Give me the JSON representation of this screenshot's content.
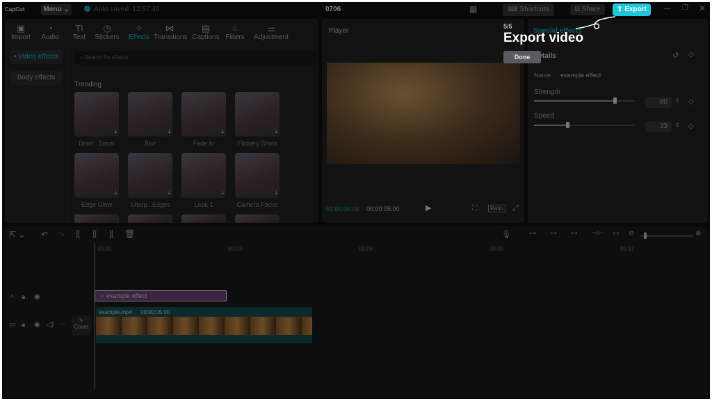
{
  "titlebar": {
    "logo": "CapCut",
    "menu": "Menu",
    "autosave": "Auto saved: 12:57:46",
    "project": "0706",
    "shortcuts": "Shortcuts",
    "share": "Share",
    "export": "Export"
  },
  "tabs": [
    {
      "label": "Import",
      "icon": "import-icon"
    },
    {
      "label": "Audio",
      "icon": "audio-icon"
    },
    {
      "label": "Text",
      "icon": "text-icon"
    },
    {
      "label": "Stickers",
      "icon": "stickers-icon"
    },
    {
      "label": "Effects",
      "icon": "effects-icon"
    },
    {
      "label": "Transitions",
      "icon": "transitions-icon"
    },
    {
      "label": "Captions",
      "icon": "captions-icon"
    },
    {
      "label": "Filters",
      "icon": "filters-icon"
    },
    {
      "label": "Adjustment",
      "icon": "adjustment-icon"
    }
  ],
  "sidebar": {
    "video_effects": "• Video effects",
    "body_effects": "Body effects"
  },
  "search_placeholder": "Search for effects",
  "trending": "Trending",
  "effects": [
    "Diam...Zoom",
    "Blur",
    "Fade In",
    "Flickery Shots",
    "Edge Glow",
    "Sharp...Edges",
    "Leak 1",
    "Camera Focus"
  ],
  "player": {
    "title": "Player",
    "current": "00:00:00:00",
    "duration": "00:00:05:00",
    "ratio": "Ratio"
  },
  "inspector": {
    "tab": "Special effects",
    "section": "Details",
    "name_label": "Name",
    "name_value": "example effect",
    "strength_label": "Strength",
    "strength_value": "80",
    "speed_label": "Speed",
    "speed_value": "33"
  },
  "tutorial": {
    "step": "5/5",
    "title": "Export video",
    "done": "Done"
  },
  "timeline": {
    "ticks": [
      "00:00",
      "00:03",
      "00:06",
      "00:09",
      "00:12"
    ],
    "effect_clip": "example effect",
    "video_clip": "example.mp4",
    "video_duration": "00:00:05:00",
    "cover": "Cover"
  },
  "colors": {
    "accent": "#1ec8d8",
    "effect_clip": "#3a2440",
    "video_clip": "#0c2a2a"
  }
}
